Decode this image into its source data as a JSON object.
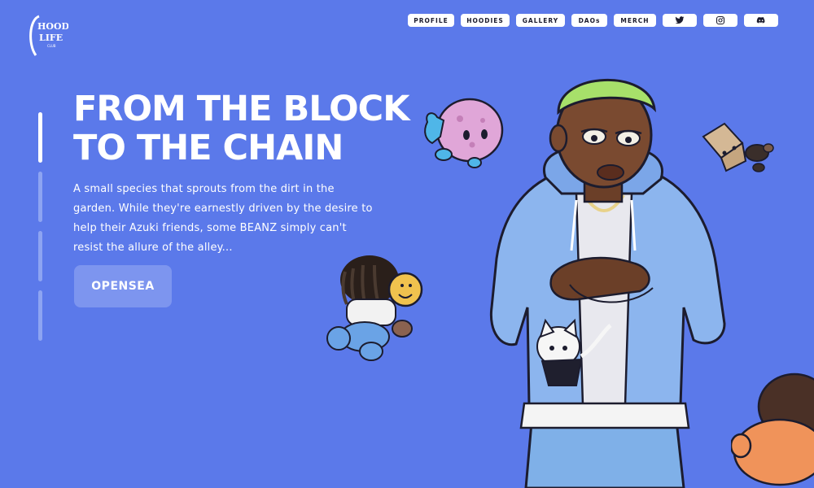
{
  "brand": {
    "logo_top": "HOOD",
    "logo_middle": "LIFE",
    "logo_bottom": "CLUB"
  },
  "nav": {
    "items": [
      {
        "label": "PROFILE"
      },
      {
        "label": "HOODIES"
      },
      {
        "label": "GALLERY"
      },
      {
        "label": "DAOs"
      },
      {
        "label": "MERCH"
      }
    ],
    "social": [
      "twitter-icon",
      "instagram-icon",
      "discord-icon"
    ]
  },
  "hero": {
    "title_line1": "FROM THE BLOCK",
    "title_line2": "TO THE CHAIN",
    "description": "A small species that sprouts from the dirt in the garden. While they're earnestly driven by the desire to help their Azuki friends, some BEANZ simply can't resist the allure of the alley...",
    "cta_label": "OPENSEA"
  },
  "colors": {
    "background": "#5b79ea",
    "text": "#ffffff",
    "button": "#7d95ef",
    "nav_button": "#ffffff"
  }
}
